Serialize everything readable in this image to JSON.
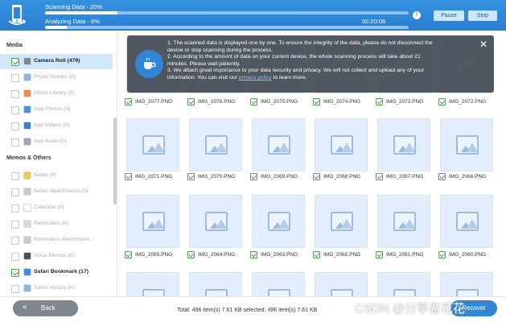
{
  "header": {
    "scanning_label": "Scanning Data - 20%",
    "scanning_progress": 0.2,
    "analyzing_label": "Analyzing Data - 6%",
    "analyzing_progress": 0.06,
    "elapsed": "00:20:06",
    "info": "!",
    "pause_label": "Pause",
    "stop_label": "Stop"
  },
  "sidebar": {
    "media_title": "Media",
    "media_items": [
      {
        "label": "Camera Roll (479)",
        "checked": true,
        "selected": true,
        "color": "#7f8790"
      },
      {
        "label": "Photo Stream (0)",
        "checked": false,
        "color": "#8bb7e0"
      },
      {
        "label": "Photo Library (0)",
        "checked": false,
        "color": "#e58f4a"
      },
      {
        "label": "App Photos (0)",
        "checked": false,
        "color": "#4a90d9"
      },
      {
        "label": "App Videos (0)",
        "checked": false,
        "color": "#3b7fd0"
      },
      {
        "label": "App Audio (0)",
        "checked": false,
        "color": "#9aa6b8"
      }
    ],
    "memos_title": "Memos & Others",
    "memo_items": [
      {
        "label": "Notes (0)",
        "checked": false,
        "color": "#f3c94b"
      },
      {
        "label": "Notes Attachments (0)",
        "checked": false,
        "color": "#c8ccd1"
      },
      {
        "label": "Calendar (0)",
        "checked": false,
        "color": "#ffffff"
      },
      {
        "label": "Reminders (0)",
        "checked": false,
        "color": "#d7d9dc"
      },
      {
        "label": "Reminders Attachment...",
        "checked": false,
        "color": "#c8ccd1"
      },
      {
        "label": "Voice Memos (0)",
        "checked": false,
        "color": "#4a4f5a"
      },
      {
        "label": "Safari Bookmark (17)",
        "checked": true,
        "color": "#3f8fe0"
      },
      {
        "label": "Safari History (0)",
        "checked": false,
        "color": "#8fb6df"
      }
    ]
  },
  "tooltip": {
    "line1": "1. The scanned data is displayed one by one. To ensure the integrity of the data, please do not disconnect the",
    "line1b": "device or stop scanning during the process.",
    "line2": "2. According to the amount of data on your current device, the whole scanning process will take about 21",
    "line2b": "minutes. Please wait patiently.",
    "line3": "3. We attach great importance to your data security and privacy. We will not collect and upload any of your",
    "line3a": "information. You can visit our",
    "link": "privacy policy",
    "line3c": "to learn more.",
    "close": "✕"
  },
  "grid": {
    "rows": [
      [
        "IMG_2077.PNG",
        "IMG_2076.PNG",
        "IMG_2075.PNG",
        "IMG_2074.PNG",
        "IMG_2073.PNG",
        "IMG_2072.PNG"
      ],
      [
        "IMG_2071.PNG",
        "IMG_2070.PNG",
        "IMG_2069.PNG",
        "IMG_2068.PNG",
        "IMG_2067.PNG",
        "IMG_2066.PNG"
      ],
      [
        "IMG_2065.PNG",
        "IMG_2064.PNG",
        "IMG_2063.PNG",
        "IMG_2062.PNG",
        "IMG_2061.PNG",
        "IMG_2060.PNG"
      ]
    ]
  },
  "footer": {
    "back_label": "Back",
    "total_text": "Total: 496 item(s) 7.61 KB   selected: 496 item(s) 7.61 KB",
    "recover_label": "Recover",
    "watermark": "CSDN @分享者花花"
  },
  "colors": {
    "accent": "#2f86d6",
    "check": "#38a238",
    "selected_row": "#cfe8fb"
  }
}
